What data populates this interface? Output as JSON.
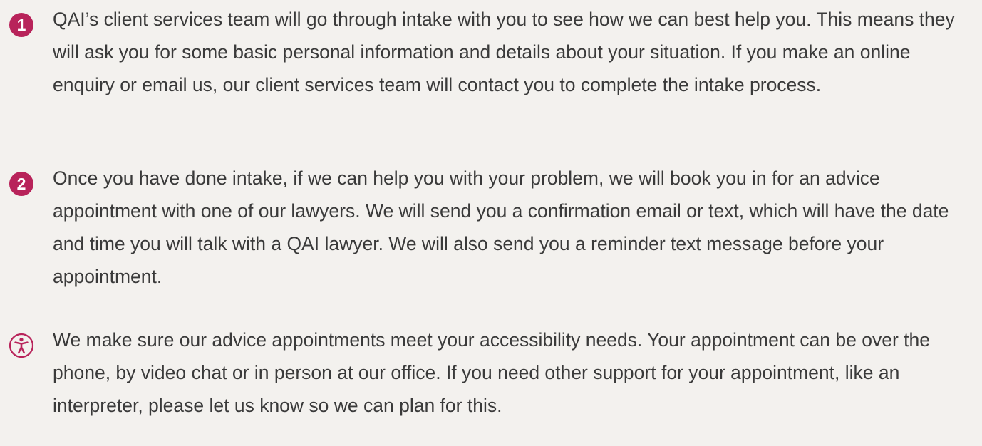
{
  "colors": {
    "accent": "#b8235a",
    "text": "#3a3a3a",
    "background": "#f3f1ee"
  },
  "steps": [
    {
      "marker": "1",
      "icon": "number-1-icon",
      "text": "QAI’s client services team will go through intake with you to see how we can best help you. This means they will ask you for some basic personal information and details about your situation. If you make an online enquiry or email us, our client services team will contact you to complete the intake process."
    },
    {
      "marker": "2",
      "icon": "number-2-icon",
      "text": "Once you have done intake, if we can help you with your problem, we will book you in for an advice appointment with one of our lawyers. We will send you a confirmation email or text, which will have the date and time you will talk with a QAI lawyer. We will also send you a reminder text message before your appointment."
    },
    {
      "icon": "accessibility-icon",
      "text": "We make sure our advice appointments meet your accessibility needs. Your appointment can be over the phone, by video chat or in person at our office. If you need other support for your appointment, like an interpreter, please let us know so we can plan for this."
    }
  ]
}
